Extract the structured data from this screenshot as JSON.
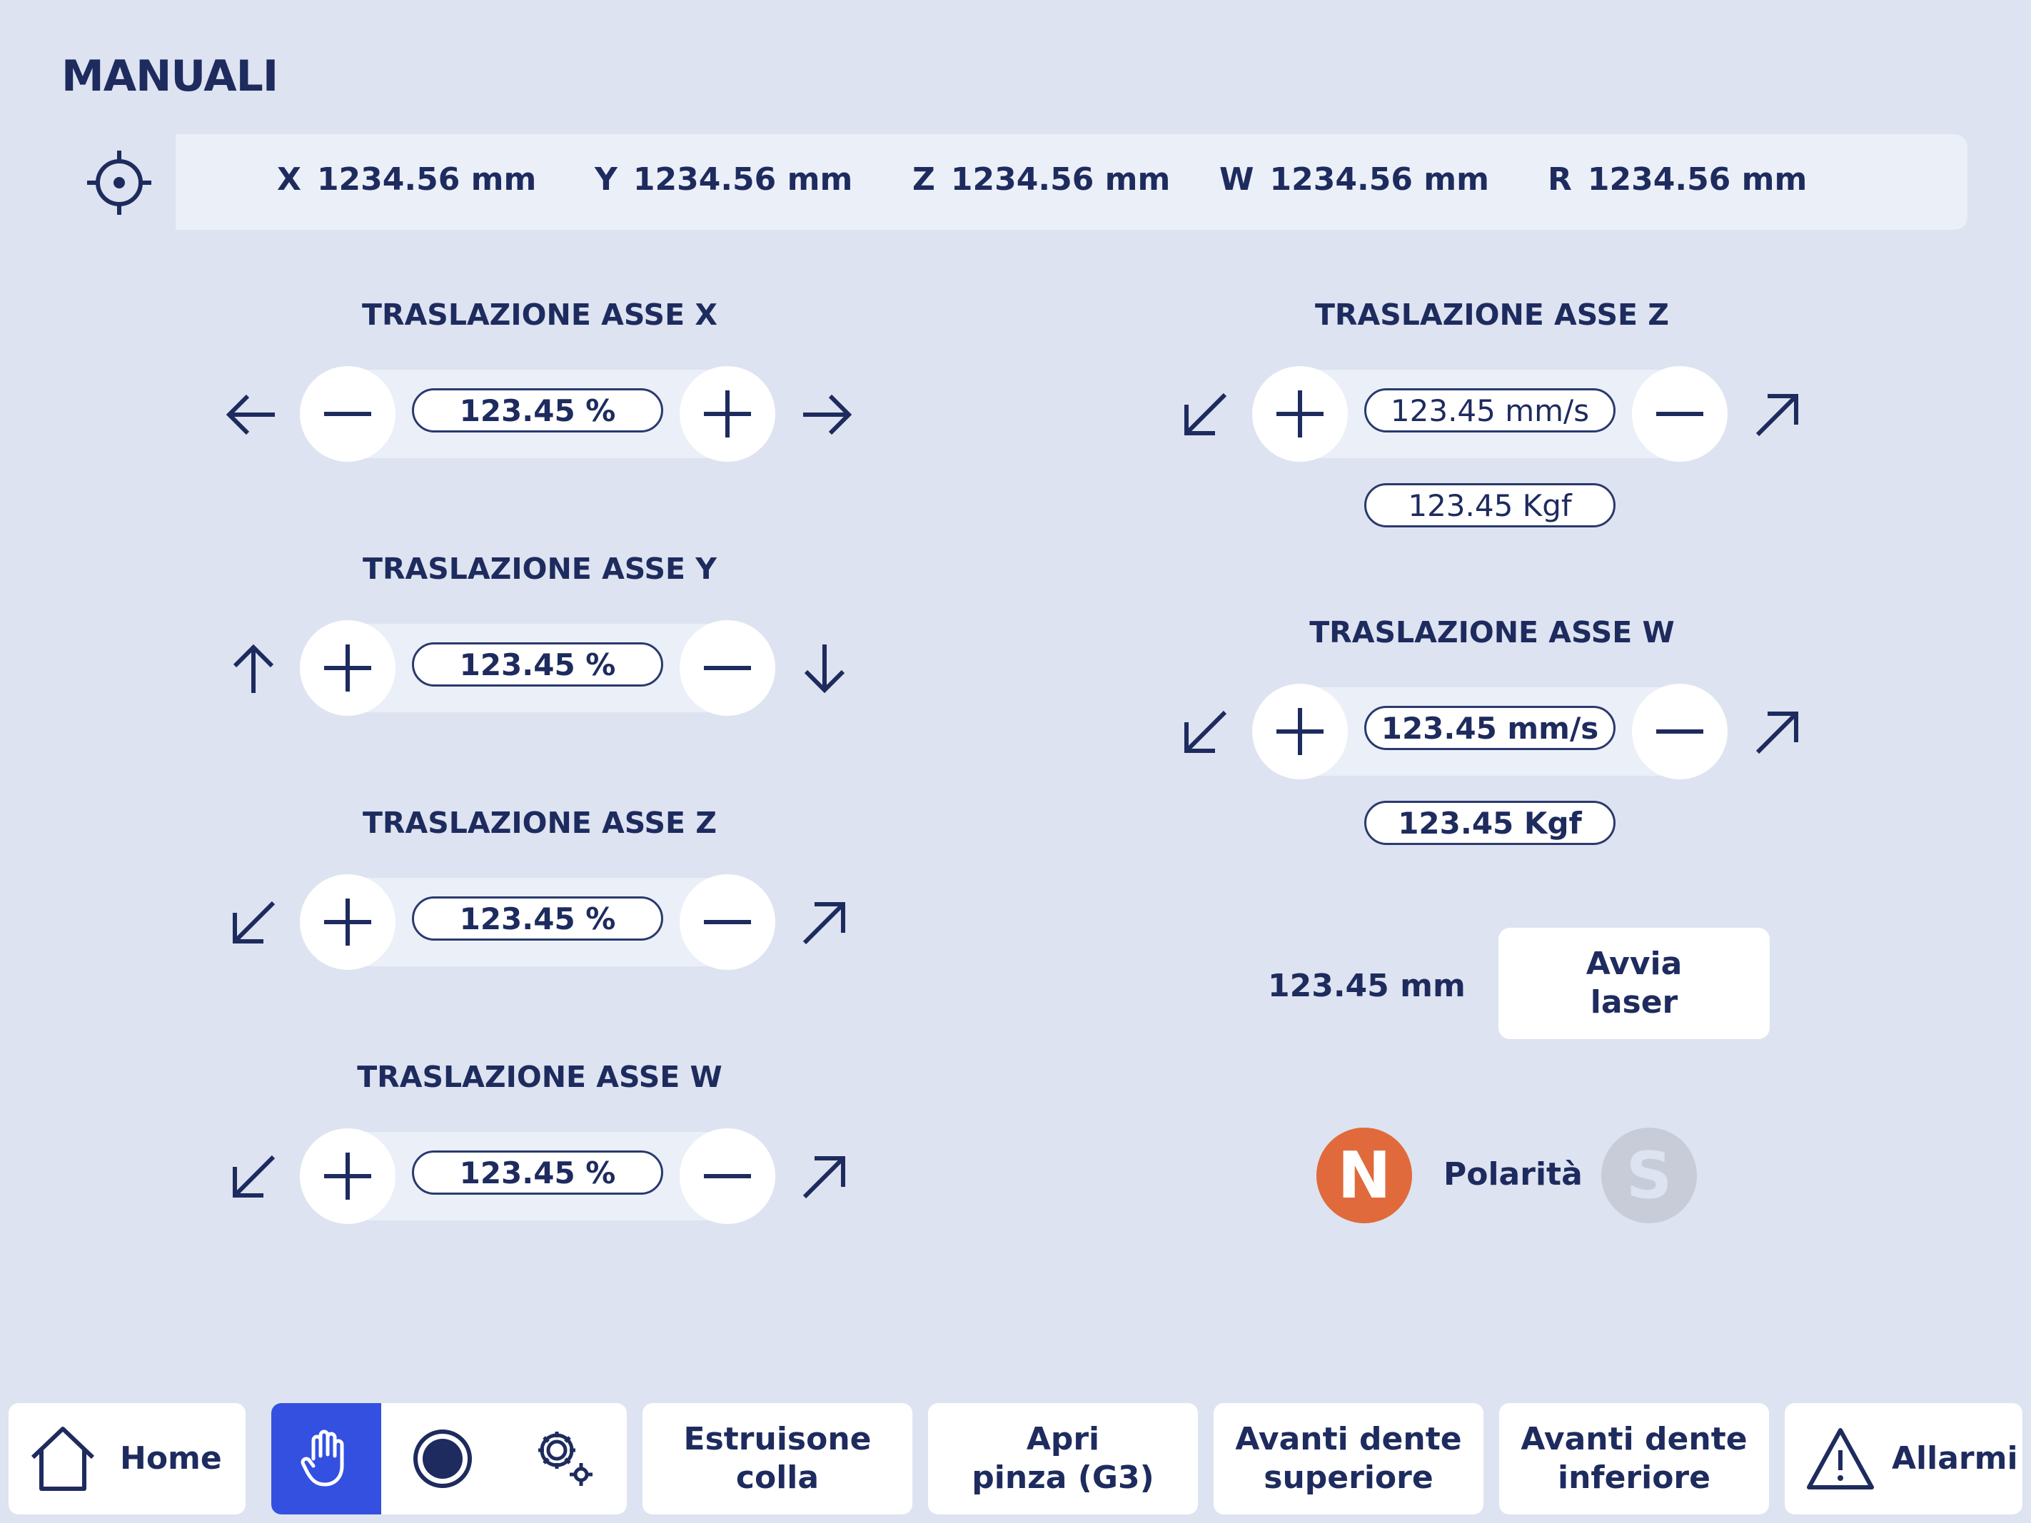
{
  "page": {
    "title": "MANUALI"
  },
  "coords": [
    {
      "axis": "X",
      "value": "1234.56 mm"
    },
    {
      "axis": "Y",
      "value": "1234.56 mm"
    },
    {
      "axis": "Z",
      "value": "1234.56 mm"
    },
    {
      "axis": "W",
      "value": "1234.56 mm"
    },
    {
      "axis": "R",
      "value": "1234.56 mm"
    }
  ],
  "left_controls": [
    {
      "title": "TRASLAZIONE ASSE X",
      "value": "123.45 %",
      "left_button": "minus",
      "right_button": "plus",
      "left_arrow": "arrow-left-icon",
      "right_arrow": "arrow-right-icon"
    },
    {
      "title": "TRASLAZIONE ASSE Y",
      "value": "123.45 %",
      "left_button": "plus",
      "right_button": "minus",
      "left_arrow": "arrow-up-icon",
      "right_arrow": "arrow-down-icon"
    },
    {
      "title": "TRASLAZIONE ASSE Z",
      "value": "123.45 %",
      "left_button": "plus",
      "right_button": "minus",
      "left_arrow": "arrow-down-left-icon",
      "right_arrow": "arrow-up-right-icon"
    },
    {
      "title": "TRASLAZIONE ASSE W",
      "value": "123.45 %",
      "left_button": "plus",
      "right_button": "minus",
      "left_arrow": "arrow-down-left-icon",
      "right_arrow": "arrow-up-right-icon"
    }
  ],
  "right_controls": [
    {
      "title": "TRASLAZIONE ASSE Z",
      "speed": "123.45 mm/s",
      "force": "123.45 Kgf",
      "left_button": "plus",
      "right_button": "minus"
    },
    {
      "title": "TRASLAZIONE ASSE W",
      "speed": "123.45 mm/s",
      "force": "123.45 Kgf",
      "left_button": "plus",
      "right_button": "minus"
    }
  ],
  "laser": {
    "value": "123.45 mm",
    "button_line1": "Avvia",
    "button_line2": "laser"
  },
  "polarity": {
    "label": "Polarità",
    "north": "N",
    "south": "S",
    "active": "N"
  },
  "nav": {
    "home": "Home",
    "estrusione_1": "Estruisone",
    "estrusione_2": "colla",
    "apri_1": "Apri",
    "apri_2": "pinza (G3)",
    "avanti_sup_1": "Avanti dente",
    "avanti_sup_2": "superiore",
    "avanti_inf_1": "Avanti dente",
    "avanti_inf_2": "inferiore",
    "allarmi": "Allarmi",
    "active_tab": "manual-hand-icon"
  },
  "colors": {
    "background": "#dde3f0",
    "panel": "#ebeff8",
    "text": "#1e2b5e",
    "accent": "#3350e0",
    "north": "#e06a3c",
    "south_inactive": "#c7ccd8"
  }
}
